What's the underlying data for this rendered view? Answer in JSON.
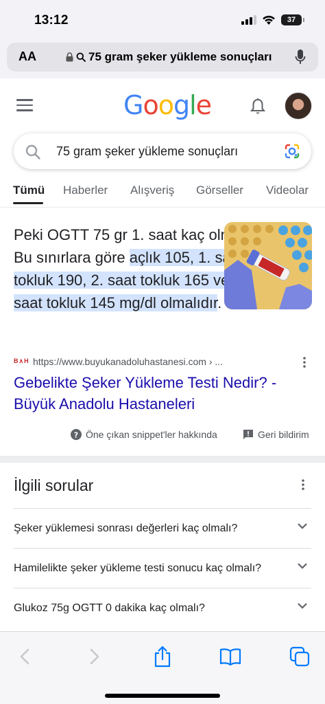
{
  "status_bar": {
    "time": "13:12",
    "battery": "37"
  },
  "address_bar": {
    "aa_label": "AA",
    "url": "75 gram şeker yükleme sonuçları"
  },
  "google": {
    "logo_letters": [
      "G",
      "o",
      "o",
      "g",
      "l",
      "e"
    ],
    "logo_colors": [
      "#4285F4",
      "#EA4335",
      "#FBBC05",
      "#4285F4",
      "#34A853",
      "#EA4335"
    ]
  },
  "search": {
    "query": "75 gram şeker yükleme sonuçları"
  },
  "tabs": [
    "Tümü",
    "Haberler",
    "Alışveriş",
    "Görseller",
    "Videolar"
  ],
  "snippet": {
    "text_plain": "Peki OGTT 75 gr 1. saat kaç olmalı? Bu sınırlara göre",
    "text_highlight": "açlık 105, 1. saat tokluk 190, 2. saat tokluk 165 ve 3. saat tokluk 145 mg/dl olmalıdır",
    "text_end": ".",
    "favicon_text": "B∧H",
    "source_url": "https://www.buyukanadoluhastanesi.com › ...",
    "title": "Gebelikte Şeker Yükleme Testi Nedir? - Büyük Anadolu Hastaneleri",
    "about_label": "Öne çıkan snippet'ler hakkında",
    "feedback_label": "Geri bildirim"
  },
  "related": {
    "title": "İlgili sorular",
    "questions": [
      "Şeker yüklemesi sonrası değerleri kaç olmalı?",
      "Hamilelikte şeker yükleme testi sonucu kaç olmalı?",
      "Glukoz 75g OGTT 0 dakika kaç olmalı?"
    ]
  },
  "colors": {
    "link": "#1a0dab",
    "highlight": "#d3e3fd",
    "safari_blue": "#007aff"
  }
}
